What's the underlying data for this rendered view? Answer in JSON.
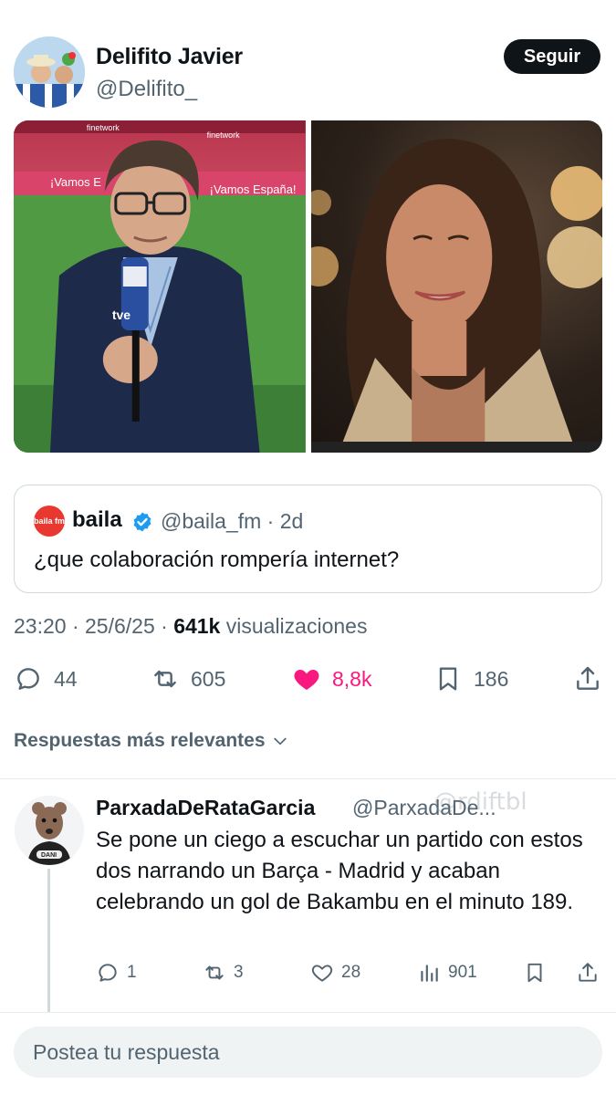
{
  "author": {
    "name": "Delifito Javier",
    "handle": "@Delifito_",
    "follow_label": "Seguir"
  },
  "media": {
    "left_banner_1": "¡Vamos E",
    "left_banner_2": "¡Vamos España!",
    "left_board": "finetwork",
    "left_mic_label": "tve"
  },
  "quote": {
    "avatar_text": "baila fm",
    "name": "baila",
    "handle": "@baila_fm · 2d",
    "text": "¿que colaboración rompería internet?"
  },
  "meta": {
    "time": "23:20 · 25/6/25 · ",
    "views": "641k",
    "views_label": " visualizaciones"
  },
  "actions": {
    "replies": "44",
    "reposts": "605",
    "likes": "8,8k",
    "bookmarks": "186",
    "like_color": "#f91880"
  },
  "replies_header": "Respuestas más relevantes",
  "reply": {
    "name": "ParxadaDeRataGarcia",
    "handle": "@ParxadaDe...",
    "watermark": "@rdiftbl",
    "text": "Se pone un ciego a escuchar un partido con estos dos narrando un Barça - Madrid y acaban celebrando un gol de Bakambu en el minuto 189.",
    "replies": "1",
    "reposts": "3",
    "likes": "28",
    "views": "901",
    "avatar_badge": "DANI"
  },
  "composer": {
    "placeholder": "Postea tu respuesta"
  },
  "colors": {
    "accent_dark": "#0f1419",
    "muted": "#536471",
    "verified_blue": "#1d9bf0",
    "baila_red": "#e8382f"
  }
}
